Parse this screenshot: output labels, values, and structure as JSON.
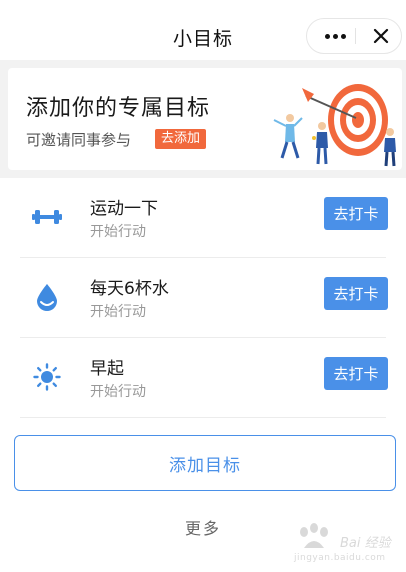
{
  "header": {
    "title": "小目标",
    "more_icon": "more-dots-icon",
    "close_icon": "close-icon"
  },
  "banner": {
    "title": "添加你的专属目标",
    "subtitle": "可邀请同事参与",
    "tag": "去添加",
    "illustration": "target-dart-illustration"
  },
  "goals": [
    {
      "name": "运动一下",
      "status": "开始行动",
      "button": "去打卡",
      "icon": "dumbbell-icon"
    },
    {
      "name": "每天6杯水",
      "status": "开始行动",
      "button": "去打卡",
      "icon": "water-drop-icon"
    },
    {
      "name": "早起",
      "status": "开始行动",
      "button": "去打卡",
      "icon": "sun-icon"
    }
  ],
  "add_goal_label": "添加目标",
  "more_label": "更多",
  "watermark": {
    "text": "Bai 经验",
    "url": "jingyan.baidu.com"
  },
  "colors": {
    "accent": "#4a90e8",
    "tag_orange": "#f1683c",
    "background_band": "#f2f2f2"
  }
}
